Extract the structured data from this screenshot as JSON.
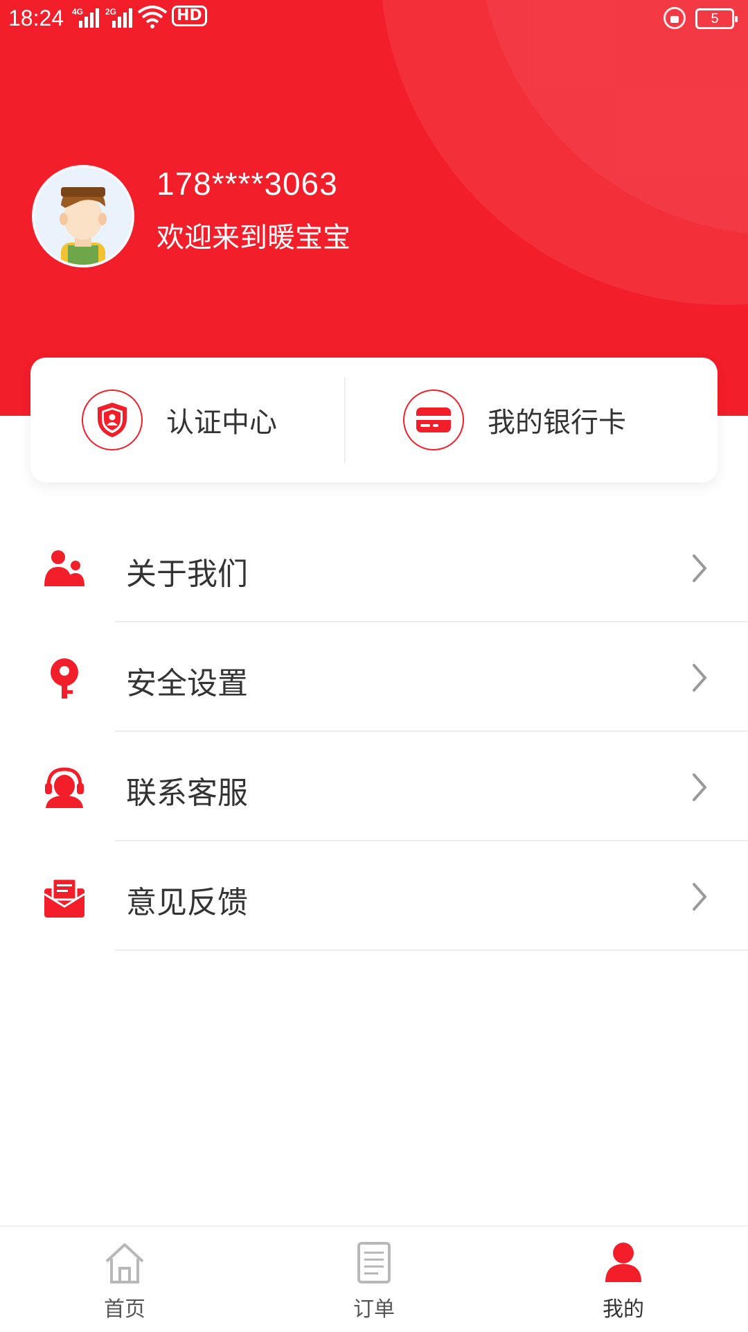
{
  "status_bar": {
    "time": "18:24",
    "signal1_label": "4G",
    "signal2_label": "2G",
    "hd_label": "HD",
    "battery": "5"
  },
  "profile": {
    "phone": "178****3063",
    "welcome": "欢迎来到暖宝宝"
  },
  "quick_actions": [
    {
      "label": "认证中心",
      "icon": "shield-user-icon"
    },
    {
      "label": "我的银行卡",
      "icon": "bank-card-icon"
    }
  ],
  "menu": [
    {
      "label": "关于我们",
      "icon": "users-icon"
    },
    {
      "label": "安全设置",
      "icon": "key-icon"
    },
    {
      "label": "联系客服",
      "icon": "headset-icon"
    },
    {
      "label": "意见反馈",
      "icon": "mail-icon"
    }
  ],
  "bottom_nav": [
    {
      "label": "首页",
      "icon": "home-icon",
      "active": false
    },
    {
      "label": "订单",
      "icon": "document-icon",
      "active": false
    },
    {
      "label": "我的",
      "icon": "person-icon",
      "active": true
    }
  ],
  "colors": {
    "primary": "#f21e2a",
    "text": "#333333",
    "inactive_icon": "#b8b8b8"
  }
}
